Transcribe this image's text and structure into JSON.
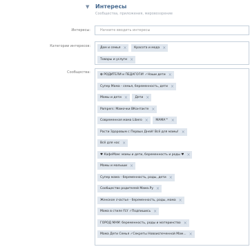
{
  "section": {
    "chevron_icon": "chevron-down-icon",
    "title": "Интересы",
    "subtitle": "Сообщества, приложения, мировоззрение"
  },
  "interests": {
    "label": "Интересы:",
    "placeholder": "Начните вводить интересы",
    "value": ""
  },
  "categories": {
    "label": "Категории интересов:",
    "tags": [
      {
        "label": "Дом и семья",
        "remove_icon": "close-icon"
      },
      {
        "label": "Красота и мода",
        "remove_icon": "close-icon"
      },
      {
        "label": "Товары и услуги",
        "remove_icon": "close-icon"
      }
    ]
  },
  "communities": {
    "label": "Сообщества:",
    "tags": [
      {
        "label": "✿ РОДИТЕЛИ и ПЕДАГОГИ! ✓Наши дети",
        "remove_icon": "close-icon"
      },
      {
        "label": "Супер Мама - семья, беременность, дети",
        "remove_icon": "close-icon"
      },
      {
        "label": "Мамы и дети",
        "remove_icon": "close-icon"
      },
      {
        "label": "Дети",
        "remove_icon": "close-icon"
      },
      {
        "label": "Pampers: Мамочки ВКонтакте",
        "remove_icon": "close-icon"
      },
      {
        "label": "Современная мама Libero",
        "remove_icon": "close-icon"
      },
      {
        "label": "МАМА™",
        "remove_icon": "close-icon"
      },
      {
        "label": "Расти Здоровым с Первых Дней! Всё для мамы!",
        "remove_icon": "close-icon"
      },
      {
        "label": "Всё для нас",
        "remove_icon": "close-icon"
      },
      {
        "label": "♥ КафеМам: мамы и дети, беременность и роды ♥",
        "remove_icon": "close-icon"
      },
      {
        "label": "Мамы и малыши",
        "remove_icon": "close-icon"
      },
      {
        "label": "Супер мама - беременность, роды, дети",
        "remove_icon": "close-icon"
      },
      {
        "label": "Сообщество родителей Мама.Ру",
        "remove_icon": "close-icon"
      },
      {
        "label": "Женское счастье - беременность, роды, мама",
        "remove_icon": "close-icon"
      },
      {
        "label": "Мама в стиле FLY ✓Подпишись",
        "remove_icon": "close-icon"
      },
      {
        "label": "ГОРОД МАМ: беременность, роды и материнство",
        "remove_icon": "close-icon"
      },
      {
        "label": "Мама Дети Семья ✓Секреты Новоиспеченной Мам...",
        "remove_icon": "close-icon"
      }
    ]
  },
  "colors": {
    "accent": "#45688e",
    "tag_background": "#dfe6ee",
    "border": "#c5d0db"
  }
}
